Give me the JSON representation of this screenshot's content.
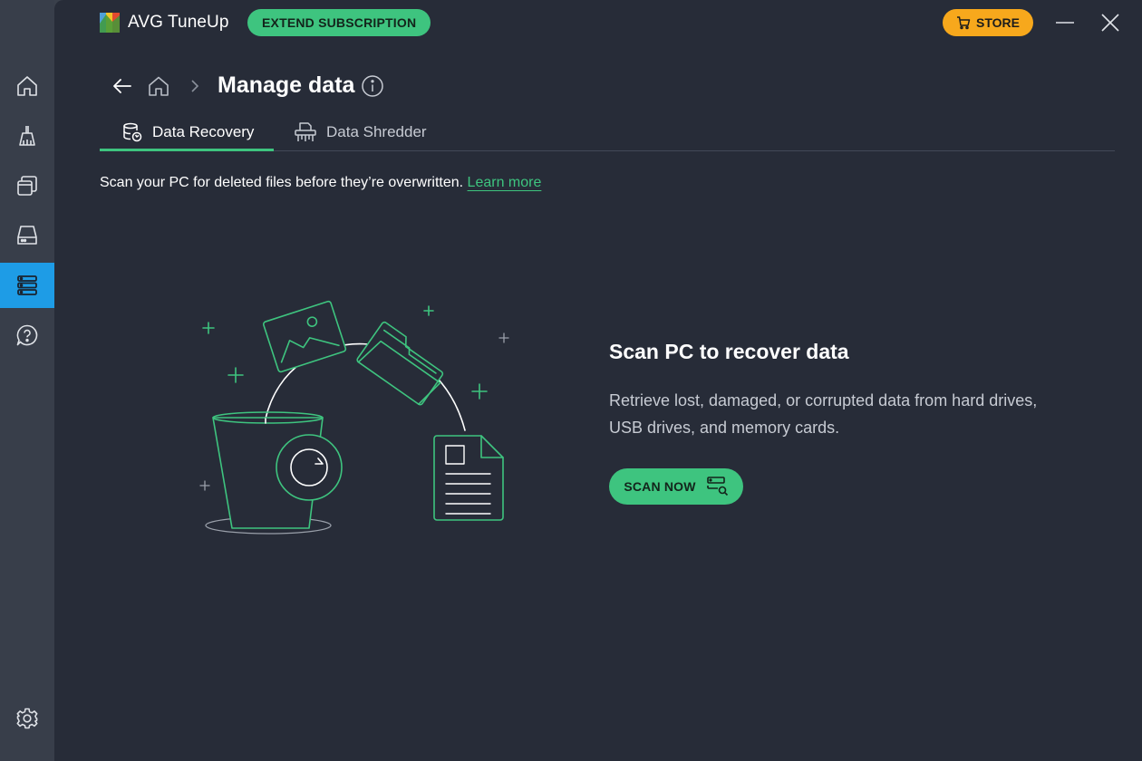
{
  "app": {
    "title": "AVG TuneUp",
    "extend_label": "EXTEND SUBSCRIPTION",
    "store_label": "STORE"
  },
  "sidebar": {
    "items": [
      {
        "icon": "home-icon",
        "active": false
      },
      {
        "icon": "broom-icon",
        "active": false
      },
      {
        "icon": "windows-stack-icon",
        "active": false
      },
      {
        "icon": "drive-icon",
        "active": false
      },
      {
        "icon": "database-icon",
        "active": true
      },
      {
        "icon": "help-icon",
        "active": false
      },
      {
        "icon": "gear-icon",
        "active": false
      }
    ]
  },
  "page": {
    "title": "Manage data"
  },
  "tabs": [
    {
      "label": "Data Recovery",
      "active": true,
      "icon": "data-recovery-icon"
    },
    {
      "label": "Data Shredder",
      "active": false,
      "icon": "shredder-icon"
    }
  ],
  "description": {
    "text": "Scan your PC for deleted files before they’re overwritten.",
    "link": "Learn more"
  },
  "cta": {
    "heading": "Scan PC to recover data",
    "text": "Retrieve lost, damaged, or corrupted data from hard drives, USB drives, and memory cards.",
    "button": "SCAN NOW"
  },
  "colors": {
    "accent_green": "#3ec47f",
    "store_orange": "#f7a81c",
    "active_blue": "#1e9ce6",
    "main_bg": "#272c38",
    "sidebar_bg": "#383e4a"
  }
}
